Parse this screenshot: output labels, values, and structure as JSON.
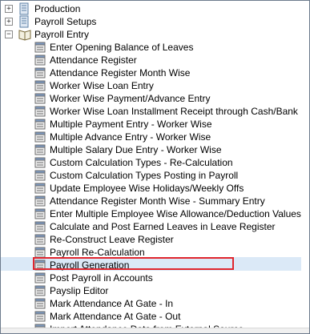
{
  "tree": {
    "root_items": [
      {
        "label": "Production",
        "expander": "+"
      },
      {
        "label": "Payroll Setups",
        "expander": "+"
      },
      {
        "label": "Payroll Entry",
        "expander": "−"
      }
    ],
    "payroll_entry_children": [
      "Enter Opening Balance of Leaves",
      "Attendance Register",
      "Attendance Register Month Wise",
      "Worker Wise Loan Entry",
      "Worker Wise Payment/Advance Entry",
      "Worker Wise Loan Installment Receipt through Cash/Bank",
      "Multiple Payment Entry - Worker Wise",
      "Multiple Advance Entry - Worker Wise",
      "Multiple Salary Due Entry - Worker Wise",
      "Custom Calculation Types - Re-Calculation",
      "Custom Calculation Types Posting in Payroll",
      "Update Employee Wise Holidays/Weekly Offs",
      "Attendance Register Month Wise - Summary Entry",
      "Enter Multiple Employee Wise Allowance/Deduction Values",
      "Calculate and Post Earned Leaves in Leave Register",
      "Re-Construct Leave Register",
      "Payroll Re-Calculation",
      "Payroll Generation",
      "Post Payroll in Accounts",
      "Payslip Editor",
      "Mark Attendance At Gate - In",
      "Mark Attendance At Gate - Out",
      "Import Attendance Data from External Source"
    ],
    "selected_item": "Payroll Generation",
    "colors": {
      "highlight_box": "#e0262e",
      "selection_bg": "#dbe9f7",
      "border": "#6d7b8c"
    }
  }
}
